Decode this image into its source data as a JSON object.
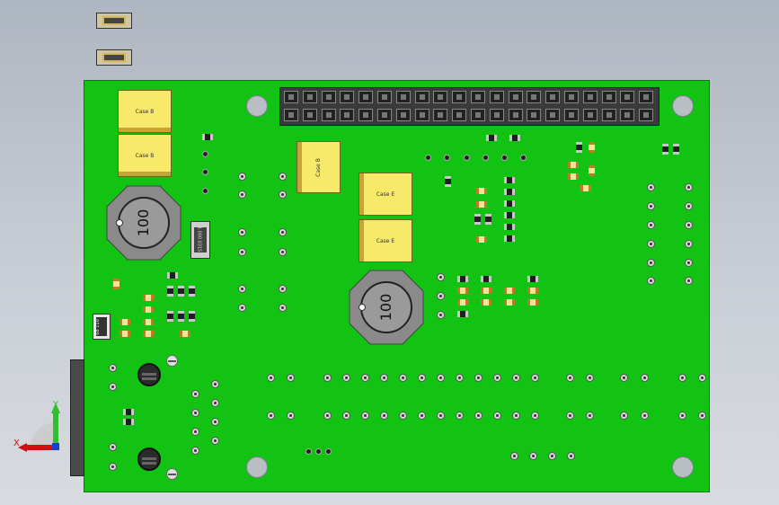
{
  "viewport": {
    "background": "light-gray gradient"
  },
  "capacitors": {
    "case_b_1": "Case B",
    "case_b_2": "Case B",
    "case_b_3": "Case B",
    "case_e_1": "Case E",
    "case_e_2": "Case E"
  },
  "inductors": {
    "left": "100",
    "center": "100"
  },
  "oscillator": {
    "label": "4.000 0315"
  },
  "ic_small": {
    "label": "68 110"
  },
  "axis": {
    "y": "Y",
    "x": "X"
  },
  "colors": {
    "board": "#13c313",
    "header": "#3b3b3b",
    "capacitor": "#f7e96a",
    "axis_y": "#2fbf2f",
    "axis_x": "#d01010"
  }
}
